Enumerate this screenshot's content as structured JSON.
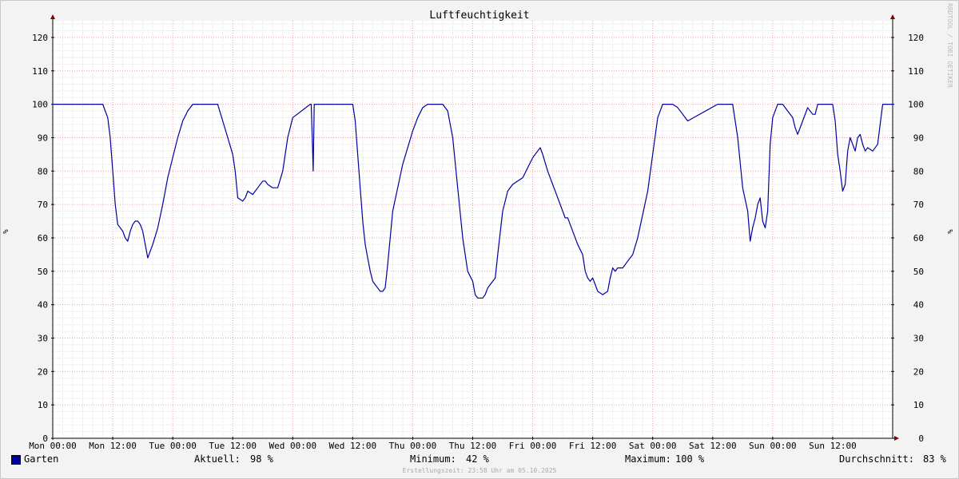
{
  "chart_data": {
    "type": "line",
    "title": "Luftfeuchtigkeit",
    "ylabel": "%",
    "ylim": [
      0,
      125
    ],
    "yticks": [
      0,
      10,
      20,
      30,
      40,
      50,
      60,
      70,
      80,
      90,
      100,
      110,
      120
    ],
    "xlim_hours": [
      0,
      168
    ],
    "xticks": [
      {
        "h": 0,
        "label": "Mon 00:00"
      },
      {
        "h": 12,
        "label": "Mon 12:00"
      },
      {
        "h": 24,
        "label": "Tue 00:00"
      },
      {
        "h": 36,
        "label": "Tue 12:00"
      },
      {
        "h": 48,
        "label": "Wed 00:00"
      },
      {
        "h": 60,
        "label": "Wed 12:00"
      },
      {
        "h": 72,
        "label": "Thu 00:00"
      },
      {
        "h": 84,
        "label": "Thu 12:00"
      },
      {
        "h": 96,
        "label": "Fri 00:00"
      },
      {
        "h": 108,
        "label": "Fri 12:00"
      },
      {
        "h": 120,
        "label": "Sat 00:00"
      },
      {
        "h": 132,
        "label": "Sat 12:00"
      },
      {
        "h": 144,
        "label": "Sun 00:00"
      },
      {
        "h": 156,
        "label": "Sun 12:00"
      }
    ],
    "grid": true,
    "legend_position": "bottom",
    "series": [
      {
        "name": "Garten",
        "color": "#0000a0",
        "x_hours": [
          0,
          10,
          10.5,
          11,
          11.5,
          12,
          12.5,
          13,
          14,
          14.5,
          15,
          15.5,
          16,
          16.5,
          17,
          17.5,
          18,
          19,
          20,
          21,
          22,
          23,
          24,
          25,
          26,
          27,
          28,
          29,
          30,
          33,
          34,
          35,
          36,
          36.5,
          37,
          38,
          38.5,
          39,
          40,
          41,
          42,
          42.5,
          43,
          44,
          45,
          46,
          46.5,
          47,
          48,
          51.5,
          51.7,
          51.9,
          52.1,
          52.3,
          60,
          60.5,
          61,
          61.5,
          62,
          62.5,
          63,
          63.5,
          64,
          65,
          65.5,
          66,
          66.5,
          67,
          68,
          70,
          72,
          73,
          74,
          75,
          76,
          77,
          78,
          79,
          80,
          81,
          82,
          83,
          84,
          84.5,
          85,
          85.5,
          86,
          86.5,
          87,
          87.5,
          88,
          88.5,
          89,
          90,
          91,
          92,
          93,
          94,
          95,
          96,
          97,
          97.5,
          98,
          99,
          100,
          101,
          102,
          102.5,
          103,
          103.5,
          104,
          105,
          106,
          106.5,
          107,
          107.5,
          108,
          108.5,
          109,
          110,
          111,
          111.5,
          112,
          112.5,
          113,
          114,
          115,
          116,
          117,
          118,
          119,
          120,
          121,
          122,
          123,
          124,
          125,
          126,
          127,
          133,
          135,
          136,
          137,
          138,
          139,
          139.5,
          140,
          140.5,
          141,
          141.5,
          142,
          142.5,
          143,
          143.5,
          144,
          145,
          146,
          147,
          148,
          148.5,
          149,
          150,
          151,
          152,
          152.5,
          153,
          154,
          156,
          156.5,
          157,
          157.5,
          158,
          158.5,
          159,
          159.5,
          160,
          160.5,
          161,
          161.5,
          162,
          162.5,
          163,
          164,
          165,
          166,
          167,
          168
        ],
        "y": [
          100,
          100,
          98,
          96,
          90,
          80,
          70,
          64,
          62,
          60,
          59,
          62,
          64,
          65,
          65,
          64,
          62,
          54,
          58,
          63,
          70,
          78,
          84,
          90,
          95,
          98,
          100,
          100,
          100,
          100,
          95,
          90,
          85,
          80,
          72,
          71,
          72,
          74,
          73,
          75,
          77,
          77,
          76,
          75,
          75,
          80,
          85,
          90,
          96,
          100,
          100,
          90,
          80,
          100,
          100,
          95,
          85,
          75,
          65,
          58,
          54,
          50,
          47,
          45,
          44,
          44,
          45,
          52,
          68,
          82,
          92,
          96,
          99,
          100,
          100,
          100,
          100,
          98,
          90,
          75,
          60,
          50,
          47,
          43,
          42,
          42,
          42,
          43,
          45,
          46,
          47,
          48,
          55,
          68,
          74,
          76,
          77,
          78,
          81,
          84,
          86,
          87,
          85,
          80,
          76,
          72,
          68,
          66,
          66,
          64,
          62,
          58,
          55,
          50,
          48,
          47,
          48,
          46,
          44,
          43,
          44,
          48,
          51,
          50,
          51,
          51,
          53,
          55,
          60,
          67,
          74,
          85,
          96,
          100,
          100,
          100,
          99,
          97,
          95,
          100,
          100,
          100,
          90,
          75,
          68,
          59,
          63,
          66,
          70,
          72,
          65,
          63,
          68,
          88,
          96,
          100,
          100,
          98,
          96,
          93,
          91,
          95,
          99,
          97,
          97,
          100,
          100,
          100,
          95,
          85,
          80,
          74,
          76,
          86,
          90,
          88,
          86,
          90,
          91,
          88,
          86,
          87,
          86,
          88,
          100,
          100,
          100,
          100,
          98,
          98
        ]
      }
    ]
  },
  "legend": {
    "series_name": "Garten",
    "aktuell_label": "Aktuell:",
    "aktuell_value": "98 %",
    "minimum_label": "Minimum:",
    "minimum_value": "42 %",
    "maximum_label": "Maximum:",
    "maximum_value": "100 %",
    "durchschnitt_label": "Durchschnitt:",
    "durchschnitt_value": "83 %"
  },
  "footer": "Erstellungszeit: 23:58 Uhr am 05.10.2025",
  "watermark": "RRDTOOL / TOBI OETIKER"
}
